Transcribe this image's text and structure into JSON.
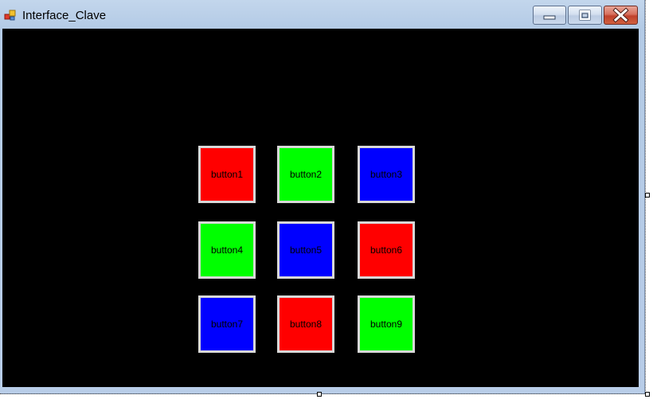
{
  "window": {
    "title": "Interface_Clave",
    "accent_color": "#b4cbe6",
    "client_background": "#000000"
  },
  "caption_buttons": {
    "minimize_icon": "minimize-icon",
    "maximize_icon": "maximize-icon",
    "close_icon": "close-icon"
  },
  "keypad": {
    "buttons": [
      {
        "label": "button1",
        "color": "#ff0000"
      },
      {
        "label": "button2",
        "color": "#00ff00"
      },
      {
        "label": "button3",
        "color": "#0000ff"
      },
      {
        "label": "button4",
        "color": "#00ff00"
      },
      {
        "label": "button5",
        "color": "#0000ff"
      },
      {
        "label": "button6",
        "color": "#ff0000"
      },
      {
        "label": "button7",
        "color": "#0000ff"
      },
      {
        "label": "button8",
        "color": "#ff0000"
      },
      {
        "label": "button9",
        "color": "#00ff00"
      }
    ]
  }
}
